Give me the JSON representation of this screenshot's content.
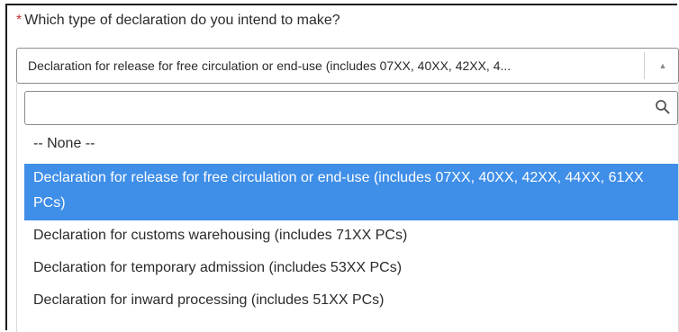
{
  "question": {
    "required_marker": "*",
    "text": "Which type of declaration do you intend to make?"
  },
  "select": {
    "value": "Declaration for release for free circulation or end-use (includes 07XX, 40XX, 42XX, 4...",
    "arrow_icon": "chevron-up-icon",
    "expanded": true
  },
  "dropdown": {
    "search": {
      "value": "",
      "placeholder": "",
      "icon": "search-icon"
    },
    "options": [
      {
        "label": "-- None --",
        "selected": false
      },
      {
        "label": "Declaration for release for free circulation or end-use (includes 07XX, 40XX, 42XX, 44XX, 61XX PCs)",
        "selected": true
      },
      {
        "label": "Declaration for customs warehousing (includes 71XX PCs)",
        "selected": false
      },
      {
        "label": "Declaration for temporary admission (includes 53XX PCs)",
        "selected": false
      },
      {
        "label": "Declaration for inward processing (includes 51XX PCs)",
        "selected": false
      }
    ]
  },
  "colors": {
    "selected_bg": "#3f8ee8",
    "selected_text": "#ffffff",
    "required": "#c23934"
  }
}
